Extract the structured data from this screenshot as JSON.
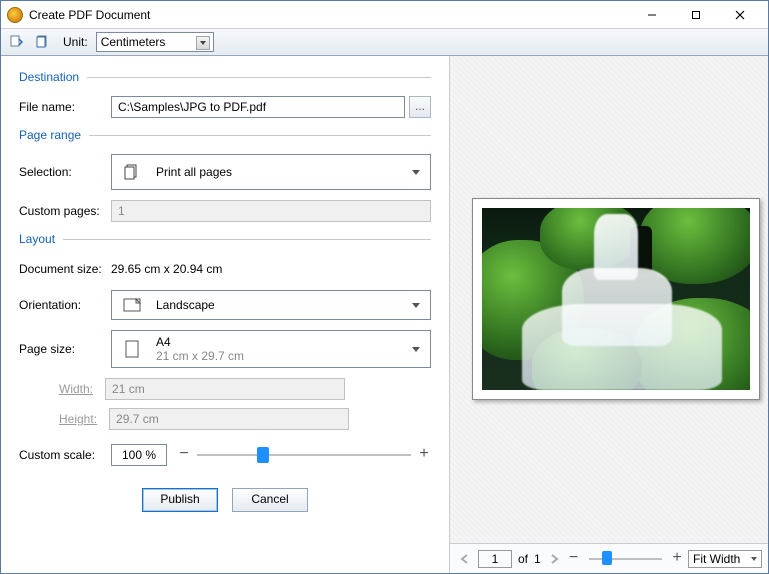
{
  "window": {
    "title": "Create PDF Document"
  },
  "toolbar": {
    "unit_label": "Unit:",
    "unit_value": "Centimeters"
  },
  "sections": {
    "destination": "Destination",
    "pageRange": "Page range",
    "layout": "Layout"
  },
  "labels": {
    "fileName": "File name:",
    "selection": "Selection:",
    "customPages": "Custom pages:",
    "documentSize": "Document size:",
    "orientation": "Orientation:",
    "pageSize": "Page size:",
    "width": "Width:",
    "height": "Height:",
    "customScale": "Custom scale:"
  },
  "fields": {
    "fileName": "C:\\Samples\\JPG to PDF.pdf",
    "selectionText": "Print all pages",
    "customPagesValue": "1",
    "documentSizeValue": "29.65 cm x 20.94 cm",
    "orientationText": "Landscape",
    "pageSizeName": "A4",
    "pageSizeDims": "21 cm x 29.7 cm",
    "widthValue": "21 cm",
    "heightValue": "29.7 cm",
    "scaleValue": "100 %"
  },
  "buttons": {
    "browse": "...",
    "publish": "Publish",
    "cancel": "Cancel",
    "minus": "−",
    "plus": "+"
  },
  "preview": {
    "pageCurrent": "1",
    "of": "of",
    "pageTotal": "1",
    "fitMode": "Fit Width",
    "scaleSliderPercent": 28,
    "zoomSliderPercent": 18
  }
}
